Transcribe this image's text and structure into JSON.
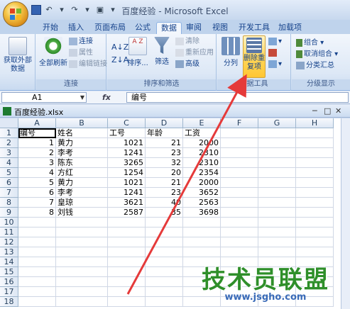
{
  "window": {
    "title": "百度经验 - Microsoft Excel"
  },
  "tabs": [
    "开始",
    "插入",
    "页面布局",
    "公式",
    "数据",
    "审阅",
    "视图",
    "开发工具",
    "加载项"
  ],
  "active_tab": "数据",
  "ribbon": {
    "get_external": "获取外部数据",
    "refresh_all": "全部刷新",
    "connections": "连接",
    "properties": "属性",
    "edit_links": "编辑链接",
    "group_connections": "连接",
    "sort": "排序...",
    "filter": "筛选",
    "clear": "清除",
    "reapply": "重新应用",
    "advanced": "高级",
    "group_sort_filter": "排序和筛选",
    "text_to_columns": "分列",
    "remove_duplicates": "删除重复项",
    "group_data_tools": "数据工具",
    "group_btn": "组合",
    "ungroup_btn": "取消组合",
    "subtotal": "分类汇总",
    "group_outline": "分级显示"
  },
  "formula_bar": {
    "name_box": "A1",
    "content": "编号"
  },
  "workbook": {
    "file_name": "百度经验.xlsx"
  },
  "columns": [
    "A",
    "B",
    "C",
    "D",
    "E",
    "F",
    "G",
    "H"
  ],
  "rows": [
    [
      "编号",
      "姓名",
      "工号",
      "年龄",
      "工资"
    ],
    [
      "1",
      "黄力",
      "1021",
      "21",
      "2000"
    ],
    [
      "2",
      "李考",
      "1241",
      "23",
      "2310"
    ],
    [
      "3",
      "陈东",
      "3265",
      "32",
      "2310"
    ],
    [
      "4",
      "方红",
      "1254",
      "20",
      "2354"
    ],
    [
      "5",
      "黄力",
      "1021",
      "21",
      "2000"
    ],
    [
      "6",
      "李考",
      "1241",
      "23",
      "3652"
    ],
    [
      "7",
      "皇琼",
      "3621",
      "40",
      "2563"
    ],
    [
      "8",
      "刘钱",
      "2587",
      "35",
      "3698"
    ]
  ],
  "row_numbers": [
    "1",
    "2",
    "3",
    "4",
    "5",
    "6",
    "7",
    "8",
    "9",
    "10",
    "11",
    "12",
    "13",
    "14",
    "15",
    "16",
    "17",
    "18"
  ],
  "watermark": {
    "main": "技术员联盟",
    "url": "www.jsgho.com"
  },
  "colors": {
    "accent": "#ffd75c",
    "arrow": "#e53a3a",
    "watermark": "#2f8f2a"
  }
}
